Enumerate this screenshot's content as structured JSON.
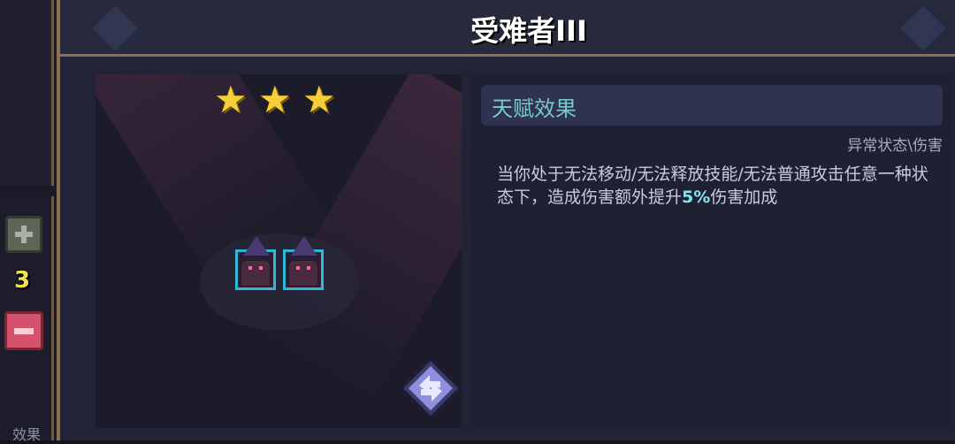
{
  "title": "受难者III",
  "stars": 3,
  "count": "3",
  "left_tab": "效果",
  "panel": {
    "header": "天赋效果",
    "tag": "异常状态\\伤害",
    "desc_prefix": "当你处于无法移动/无法释放技能/无法普通攻击任意一种状态下，造成伤害额外提升",
    "desc_highlight": "5%",
    "desc_suffix": "伤害加成"
  },
  "icons": {
    "star": "star-icon",
    "plus": "plus-icon",
    "minus": "minus-icon",
    "refresh": "refresh-icon"
  },
  "colors": {
    "highlight": "#7fe6ee",
    "star": "#f5cf3b",
    "count": "#f4e24a"
  }
}
